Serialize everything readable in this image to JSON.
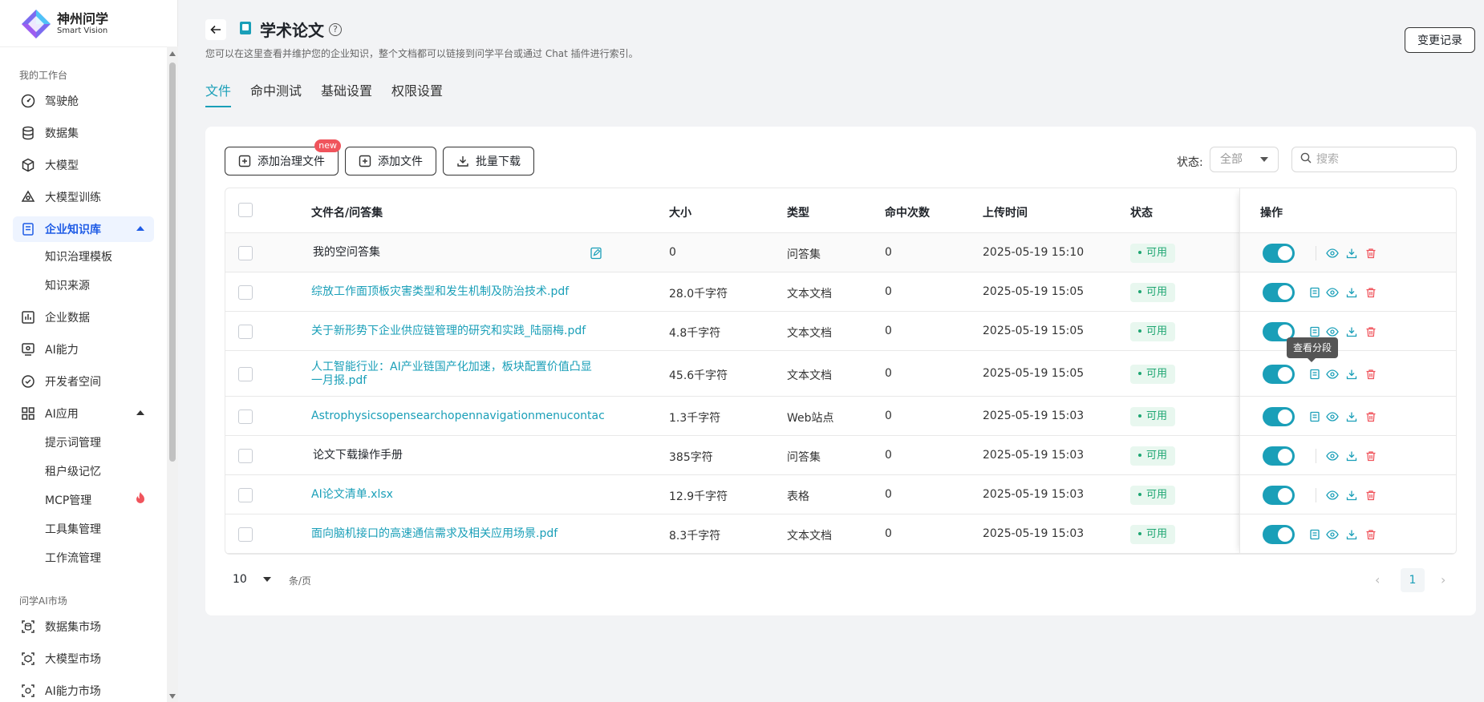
{
  "brand": {
    "name_cn": "神州问学",
    "name_en": "Smart Vision"
  },
  "sidebar": {
    "group_workbench": "我的工作台",
    "items": [
      {
        "label": "驾驶舱",
        "icon": "dashboard-icon"
      },
      {
        "label": "数据集",
        "icon": "database-icon"
      },
      {
        "label": "大模型",
        "icon": "cube-icon"
      },
      {
        "label": "大模型训练",
        "icon": "training-icon"
      },
      {
        "label": "企业知识库",
        "icon": "knowledge-icon"
      },
      {
        "label": "企业数据",
        "icon": "chart-icon"
      },
      {
        "label": "AI能力",
        "icon": "ai-ability-icon"
      },
      {
        "label": "开发者空间",
        "icon": "developer-icon"
      },
      {
        "label": "AI应用",
        "icon": "grid-icon"
      }
    ],
    "knowledge_sub": [
      "知识治理模板",
      "知识来源"
    ],
    "app_sub": [
      "提示词管理",
      "租户级记忆",
      "MCP管理",
      "工具集管理",
      "工作流管理"
    ],
    "group_market": "问学AI市场",
    "market_items": [
      {
        "label": "数据集市场",
        "icon": "dataset-market-icon"
      },
      {
        "label": "大模型市场",
        "icon": "model-market-icon"
      },
      {
        "label": "AI能力市场",
        "icon": "ability-market-icon"
      }
    ]
  },
  "header": {
    "title": "学术论文",
    "subtitle": "您可以在这里查看并维护您的企业知识，整个文档都可以链接到问学平台或通过 Chat 插件进行索引。",
    "changelog": "变更记录"
  },
  "tabs": [
    "文件",
    "命中测试",
    "基础设置",
    "权限设置"
  ],
  "toolbar": {
    "add_governed": "添加治理文件",
    "new_badge": "new",
    "add_file": "添加文件",
    "batch_download": "批量下载",
    "status_label": "状态:",
    "status_value": "全部",
    "search_placeholder": "搜索"
  },
  "table": {
    "columns": [
      "文件名/问答集",
      "大小",
      "类型",
      "命中次数",
      "上传时间",
      "状态",
      "操作"
    ],
    "rows": [
      {
        "name": "我的空问答集",
        "size": "0",
        "type": "问答集",
        "hits": "0",
        "time": "2025-05-19 15:10",
        "status": "可用"
      },
      {
        "name": "综放工作面顶板灾害类型和发生机制及防治技术.pdf",
        "size": "28.0千字符",
        "type": "文本文档",
        "hits": "0",
        "time": "2025-05-19 15:05",
        "status": "可用"
      },
      {
        "name": "关于新形势下企业供应链管理的研究和实践_陆丽梅.pdf",
        "size": "4.8千字符",
        "type": "文本文档",
        "hits": "0",
        "time": "2025-05-19 15:05",
        "status": "可用"
      },
      {
        "name": "人工智能行业：AI产业链国产化加速，板块配置价值凸显一月报.pdf",
        "size": "45.6千字符",
        "type": "文本文档",
        "hits": "0",
        "time": "2025-05-19 15:05",
        "status": "可用"
      },
      {
        "name": "Astrophysicsopensearchopennavigationmenucontac",
        "size": "1.3千字符",
        "type": "Web站点",
        "hits": "0",
        "time": "2025-05-19 15:03",
        "status": "可用"
      },
      {
        "name": "论文下载操作手册",
        "size": "385字符",
        "type": "问答集",
        "hits": "0",
        "time": "2025-05-19 15:03",
        "status": "可用"
      },
      {
        "name": "AI论文清单.xlsx",
        "size": "12.9千字符",
        "type": "表格",
        "hits": "0",
        "time": "2025-05-19 15:03",
        "status": "可用"
      },
      {
        "name": "面向脑机接口的高速通信需求及相关应用场景.pdf",
        "size": "8.3千字符",
        "type": "文本文档",
        "hits": "0",
        "time": "2025-05-19 15:03",
        "status": "可用"
      }
    ],
    "tooltip": "查看分段"
  },
  "pagination": {
    "page_size": "10",
    "unit": "条/页",
    "current": "1"
  },
  "colors": {
    "accent": "#1a9fb8",
    "danger": "#f0545c",
    "success": "#1ea672",
    "nav_active": "#1f5ce6"
  }
}
